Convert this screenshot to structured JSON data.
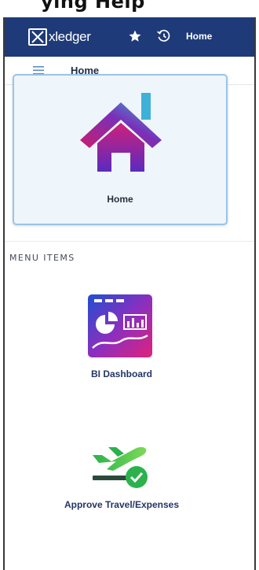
{
  "caption": {
    "text": "ying Help"
  },
  "app": {
    "logo_text": "xledger",
    "breadcrumb_home": "Home",
    "page_title": "Home",
    "colors": {
      "topbar": "#1e3a78",
      "card_border": "#9cc4e6",
      "card_bg": "#eef6fc"
    }
  },
  "home_card": {
    "label": "Home",
    "icon": "home-icon"
  },
  "menu": {
    "section_title": "MENU ITEMS",
    "items": [
      {
        "label": "BI Dashboard",
        "icon": "bi-dashboard-icon"
      },
      {
        "label": "Approve Travel/Expenses",
        "icon": "approve-travel-icon"
      }
    ]
  }
}
